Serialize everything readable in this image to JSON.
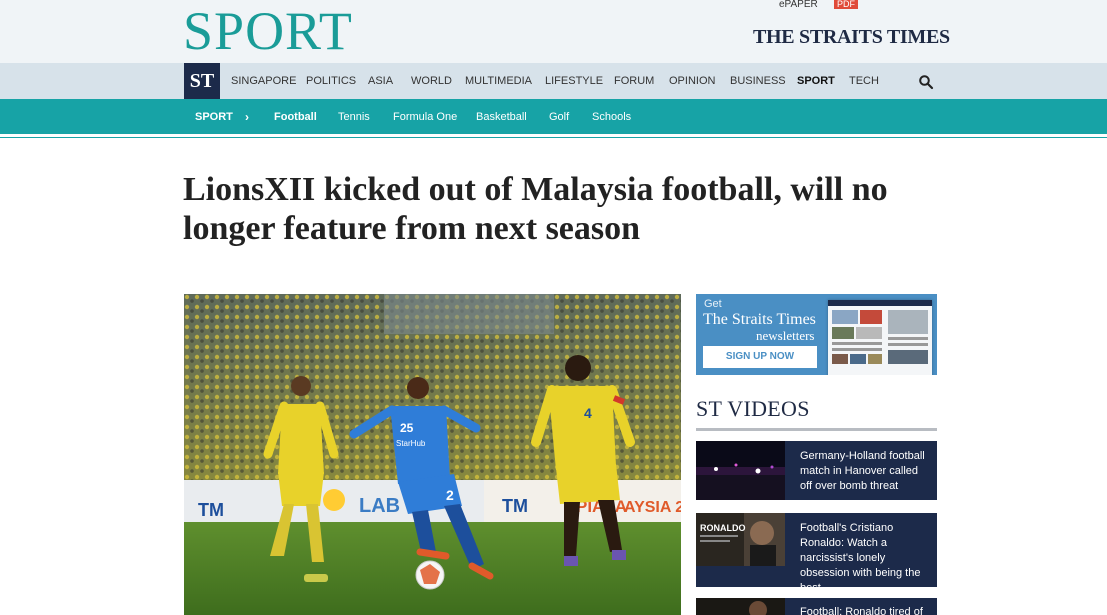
{
  "masthead": {
    "section_title": "SPORT",
    "epaper_label": "ePAPER",
    "pdf_label": "PDF",
    "brand": "THE STRAITS TIMES"
  },
  "logo": {
    "text": "ST"
  },
  "nav": {
    "items": [
      {
        "label": "SINGAPORE"
      },
      {
        "label": "POLITICS"
      },
      {
        "label": "ASIA"
      },
      {
        "label": "WORLD"
      },
      {
        "label": "MULTIMEDIA"
      },
      {
        "label": "LIFESTYLE"
      },
      {
        "label": "FORUM"
      },
      {
        "label": "OPINION"
      },
      {
        "label": "BUSINESS"
      },
      {
        "label": "SPORT"
      },
      {
        "label": "TECH"
      }
    ],
    "active": "SPORT"
  },
  "subnav": {
    "section": "SPORT",
    "chevron": "›",
    "items": [
      {
        "label": "Football"
      },
      {
        "label": "Tennis"
      },
      {
        "label": "Formula One"
      },
      {
        "label": "Basketball"
      },
      {
        "label": "Golf"
      },
      {
        "label": "Schools"
      }
    ]
  },
  "article": {
    "headline": "LionsXII kicked out of Malaysia football, will no longer feature from next season"
  },
  "newsletter": {
    "get": "Get",
    "title": "The Straits Times",
    "subtitle": "newsletters",
    "button": "SIGN UP NOW"
  },
  "videos": {
    "title": "ST VIDEOS",
    "items": [
      {
        "title": "Germany-Holland football match in Hanover called off over bomb threat"
      },
      {
        "title": "Football's Cristiano Ronaldo: Watch a narcissist's lonely obsession with being the best",
        "thumb_label": "RONALDO"
      },
      {
        "title": "Football: Ronaldo tired of"
      }
    ]
  },
  "photo": {
    "jersey_numbers": [
      "25",
      "2",
      "4"
    ],
    "board_texts": [
      "TM",
      "LAB",
      "TM",
      "PIALA",
      "AYSIA 2",
      "StarHub"
    ]
  },
  "colors": {
    "teal": "#17a3a6",
    "navy": "#1c2a4a",
    "nav_bg": "#d7e2ea",
    "masthead_bg": "#f0f4f7"
  }
}
